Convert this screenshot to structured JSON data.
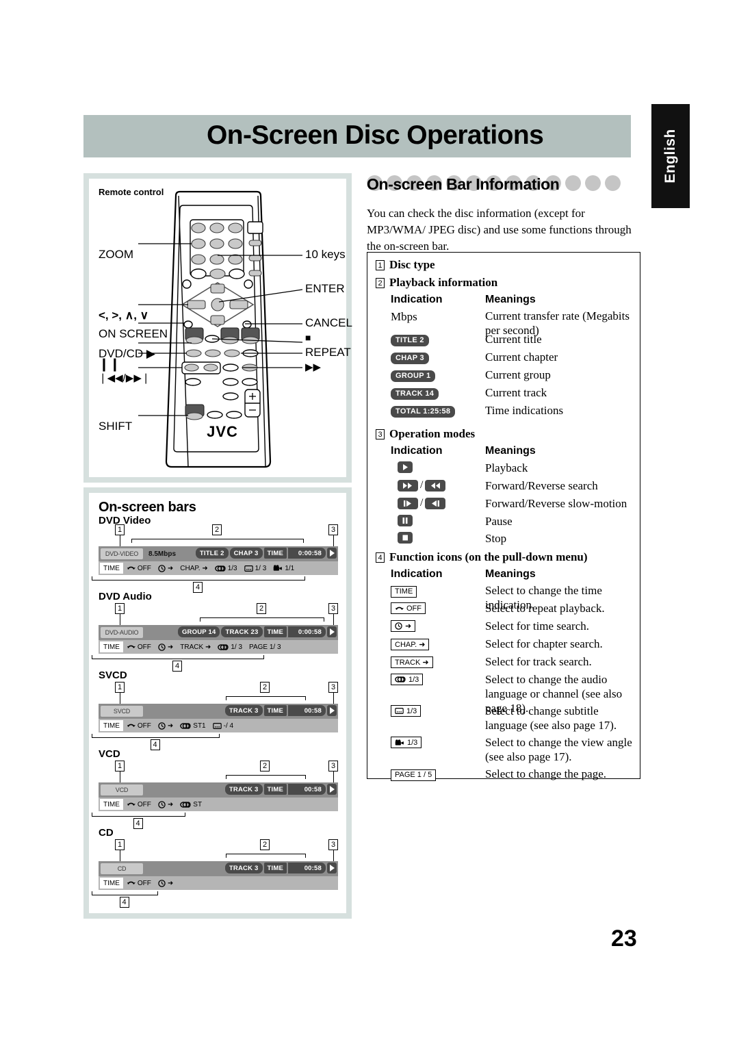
{
  "header": {
    "title": "On-Screen Disc Operations",
    "language_tab": "English"
  },
  "remote_panel": {
    "label": "Remote control",
    "brand": "JVC",
    "callouts_left": [
      {
        "label": "ZOOM"
      },
      {
        "label": "<, >, ∧, ∨"
      },
      {
        "label": "ON SCREEN"
      },
      {
        "label": "DVD/CD ▶"
      },
      {
        "label": "❙❙"
      },
      {
        "label": "❘◀◀/▶▶❘"
      },
      {
        "label": "SHIFT"
      }
    ],
    "callouts_right": [
      {
        "label": "10 keys"
      },
      {
        "label": "ENTER"
      },
      {
        "label": "CANCEL"
      },
      {
        "label": "■"
      },
      {
        "label": "REPEAT"
      },
      {
        "label": "▶▶"
      }
    ]
  },
  "bars_panel": {
    "heading": "On-screen bars",
    "callout_numbers": [
      "1",
      "2",
      "3",
      "4"
    ],
    "bars": [
      {
        "label": "DVD Video",
        "disc_type": "DVD-VIDEO",
        "rate": "8.5Mbps",
        "playback": [
          {
            "text": "TITLE  2",
            "style": "pill"
          },
          {
            "text": "CHAP  3",
            "style": "pill"
          },
          {
            "text": "TIME",
            "style": "time"
          },
          {
            "text": "0:00:58",
            "style": "timeval"
          }
        ],
        "op_mode": "play-icon",
        "functions": [
          {
            "icon": "none",
            "text": "TIME",
            "selected": true
          },
          {
            "icon": "repeat-icon",
            "text": "OFF",
            "selected": false
          },
          {
            "icon": "clock-icon",
            "text": "➜",
            "selected": false
          },
          {
            "icon": "none",
            "text": "CHAP. ➜",
            "selected": false
          },
          {
            "icon": "audio-icon",
            "text": "1/3",
            "selected": false
          },
          {
            "icon": "subtitle-icon",
            "text": "1/ 3",
            "selected": false
          },
          {
            "icon": "angle-icon",
            "text": "1/1",
            "selected": false
          }
        ]
      },
      {
        "label": "DVD Audio",
        "disc_type": "DVD-AUDIO",
        "rate": "",
        "playback": [
          {
            "text": "GROUP 14",
            "style": "pill"
          },
          {
            "text": "TRACK 23",
            "style": "pill"
          },
          {
            "text": "TIME",
            "style": "time"
          },
          {
            "text": "0:00:58",
            "style": "timeval"
          }
        ],
        "op_mode": "play-icon",
        "functions": [
          {
            "icon": "none",
            "text": "TIME",
            "selected": true
          },
          {
            "icon": "repeat-icon",
            "text": "OFF",
            "selected": false
          },
          {
            "icon": "clock-icon",
            "text": "➜",
            "selected": false
          },
          {
            "icon": "none",
            "text": "TRACK ➜",
            "selected": false
          },
          {
            "icon": "audio-icon",
            "text": "1/ 3",
            "selected": false
          },
          {
            "icon": "none",
            "text": "PAGE 1/ 3",
            "selected": false
          }
        ]
      },
      {
        "label": "SVCD",
        "disc_type": "SVCD",
        "rate": "",
        "playback": [
          {
            "text": "TRACK  3",
            "style": "pill"
          },
          {
            "text": "TIME",
            "style": "time"
          },
          {
            "text": "00:58",
            "style": "timeval"
          }
        ],
        "op_mode": "play-icon",
        "functions": [
          {
            "icon": "none",
            "text": "TIME",
            "selected": true
          },
          {
            "icon": "repeat-icon",
            "text": "OFF",
            "selected": false
          },
          {
            "icon": "clock-icon",
            "text": "➜",
            "selected": false
          },
          {
            "icon": "audio-icon",
            "text": "ST1",
            "selected": false
          },
          {
            "icon": "subtitle-icon",
            "text": "-/ 4",
            "selected": false
          }
        ]
      },
      {
        "label": "VCD",
        "disc_type": "VCD",
        "rate": "",
        "playback": [
          {
            "text": "TRACK  3",
            "style": "pill"
          },
          {
            "text": "TIME",
            "style": "time"
          },
          {
            "text": "00:58",
            "style": "timeval"
          }
        ],
        "op_mode": "play-icon",
        "functions": [
          {
            "icon": "none",
            "text": "TIME",
            "selected": true
          },
          {
            "icon": "repeat-icon",
            "text": "OFF",
            "selected": false
          },
          {
            "icon": "clock-icon",
            "text": "➜",
            "selected": false
          },
          {
            "icon": "audio-icon",
            "text": "ST",
            "selected": false
          }
        ]
      },
      {
        "label": "CD",
        "disc_type": "CD",
        "rate": "",
        "playback": [
          {
            "text": "TRACK  3",
            "style": "pill"
          },
          {
            "text": "TIME",
            "style": "time"
          },
          {
            "text": "00:58",
            "style": "timeval"
          }
        ],
        "op_mode": "play-icon",
        "functions": [
          {
            "icon": "none",
            "text": "TIME",
            "selected": true
          },
          {
            "icon": "repeat-icon",
            "text": "OFF",
            "selected": false
          },
          {
            "icon": "clock-icon",
            "text": "➜",
            "selected": false
          }
        ]
      }
    ]
  },
  "section": {
    "heading": "On-screen Bar Information",
    "intro": "You can check the disc information (except for MP3/WMA/ JPEG disc) and use some functions through the on-screen bar."
  },
  "infobox": {
    "groups": [
      {
        "num": "1",
        "title": "Disc type"
      },
      {
        "num": "2",
        "title": "Playback information"
      },
      {
        "num": "3",
        "title": "Operation modes"
      },
      {
        "num": "4",
        "title": "Function icons (on the pull-down menu)"
      }
    ],
    "col_indication": "Indication",
    "col_meanings": "Meanings",
    "playback_rows": [
      {
        "indication": "Mbps",
        "kind": "plain",
        "meaning": "Current transfer rate (Megabits per second)"
      },
      {
        "indication": "TITLE  2",
        "kind": "chip-dark",
        "meaning": "Current title"
      },
      {
        "indication": "CHAP  3",
        "kind": "chip-dark",
        "meaning": "Current chapter"
      },
      {
        "indication": "GROUP 1",
        "kind": "chip-dark",
        "meaning": "Current group"
      },
      {
        "indication": "TRACK 14",
        "kind": "chip-dark",
        "meaning": "Current track"
      },
      {
        "indication": "TOTAL 1:25:58",
        "kind": "chip-dark",
        "meaning": "Time indications"
      }
    ],
    "opmode_rows": [
      {
        "icon": "play-icon",
        "meaning": "Playback"
      },
      {
        "icon": "fast-forward-rewind-icon",
        "meaning": "Forward/Reverse search"
      },
      {
        "icon": "slow-forward-reverse-icon",
        "meaning": "Forward/Reverse slow-motion"
      },
      {
        "icon": "pause-icon",
        "meaning": "Pause"
      },
      {
        "icon": "stop-icon",
        "meaning": "Stop"
      }
    ],
    "function_rows": [
      {
        "icon": "none",
        "text": "TIME",
        "meaning": "Select to change the time indication."
      },
      {
        "icon": "repeat-icon",
        "text": "OFF",
        "meaning": "Select to repeat playback."
      },
      {
        "icon": "clock-icon",
        "text": "➜",
        "meaning": "Select for time search."
      },
      {
        "icon": "none",
        "text": "CHAP. ➜",
        "meaning": "Select for chapter search."
      },
      {
        "icon": "none",
        "text": "TRACK ➜",
        "meaning": "Select for track search."
      },
      {
        "icon": "audio-icon",
        "text": "1/3",
        "meaning": "Select to change the audio language or channel (see also page 18)."
      },
      {
        "icon": "subtitle-icon",
        "text": "1/3",
        "meaning": "Select to change subtitle language (see also page 17)."
      },
      {
        "icon": "angle-icon",
        "text": "1/3",
        "meaning": "Select to change the view angle (see also page 17)."
      },
      {
        "icon": "none",
        "text": "PAGE 1 / 5",
        "meaning": "Select to change the page."
      }
    ]
  },
  "footer": {
    "page_number": "23"
  },
  "colors": {
    "title_bar": "#b3c0be",
    "panel_border": "#d6e0de",
    "bar_top": "#8d8d8d",
    "bar_bottom": "#b5b5b5",
    "chip_dark": "#4a4a4a",
    "lang_tab": "#111111"
  }
}
